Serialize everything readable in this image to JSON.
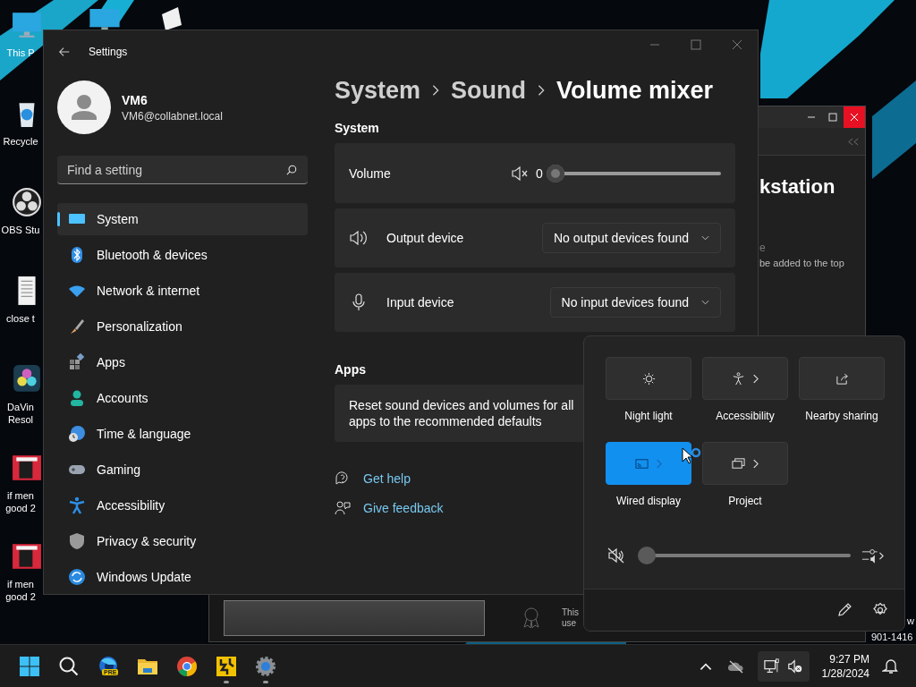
{
  "desktop": {
    "icons": [
      {
        "label": "This P"
      },
      {
        "label": "Recycle"
      },
      {
        "label": "OBS Stu"
      },
      {
        "label": "close t"
      },
      {
        "label": "DaVin\nResol"
      },
      {
        "label": "if men\ngood 2"
      },
      {
        "label": "if men\ngood 2"
      }
    ],
    "corner_text": [
      "w",
      "901-1416"
    ]
  },
  "background_window": {
    "heading": "kstation",
    "fragment": "e",
    "note": "be added to the top",
    "footer_text": "This\nuse"
  },
  "settings": {
    "title": "Settings",
    "user": {
      "name": "VM6",
      "email": "VM6@collabnet.local"
    },
    "search": {
      "placeholder": "Find a setting"
    },
    "nav": [
      {
        "label": "System",
        "selected": true
      },
      {
        "label": "Bluetooth & devices",
        "selected": false
      },
      {
        "label": "Network & internet",
        "selected": false
      },
      {
        "label": "Personalization",
        "selected": false
      },
      {
        "label": "Apps",
        "selected": false
      },
      {
        "label": "Accounts",
        "selected": false
      },
      {
        "label": "Time & language",
        "selected": false
      },
      {
        "label": "Gaming",
        "selected": false
      },
      {
        "label": "Accessibility",
        "selected": false
      },
      {
        "label": "Privacy & security",
        "selected": false
      },
      {
        "label": "Windows Update",
        "selected": false
      }
    ],
    "breadcrumb": [
      "System",
      "Sound",
      "Volume mixer"
    ],
    "system_section": {
      "heading": "System",
      "volume": {
        "label": "Volume",
        "muted": true,
        "reading": "0",
        "level": 0
      },
      "devices": [
        {
          "label": "Output device",
          "value": "No output devices found"
        },
        {
          "label": "Input device",
          "value": "No input devices found"
        }
      ]
    },
    "apps_section": {
      "heading": "Apps",
      "reset_text": "Reset sound devices and volumes for all apps to the recommended defaults"
    },
    "links": [
      "Get help",
      "Give feedback"
    ]
  },
  "quick_settings": {
    "tiles": [
      {
        "label": "Night light",
        "selected": false,
        "chevron": false
      },
      {
        "label": "Accessibility",
        "selected": false,
        "chevron": true
      },
      {
        "label": "Nearby sharing",
        "selected": false,
        "chevron": false
      },
      {
        "label": "Wired display",
        "selected": true,
        "chevron": true
      },
      {
        "label": "Project",
        "selected": false,
        "chevron": true
      }
    ],
    "volume": {
      "muted": true,
      "level": 0
    }
  },
  "taskbar": {
    "apps": [
      {
        "badge": "PRE",
        "running": false
      },
      {
        "running": false
      },
      {
        "running": false
      },
      {
        "running": true
      },
      {
        "running": true
      }
    ],
    "time": "9:27 PM",
    "date": "1/28/2024"
  }
}
